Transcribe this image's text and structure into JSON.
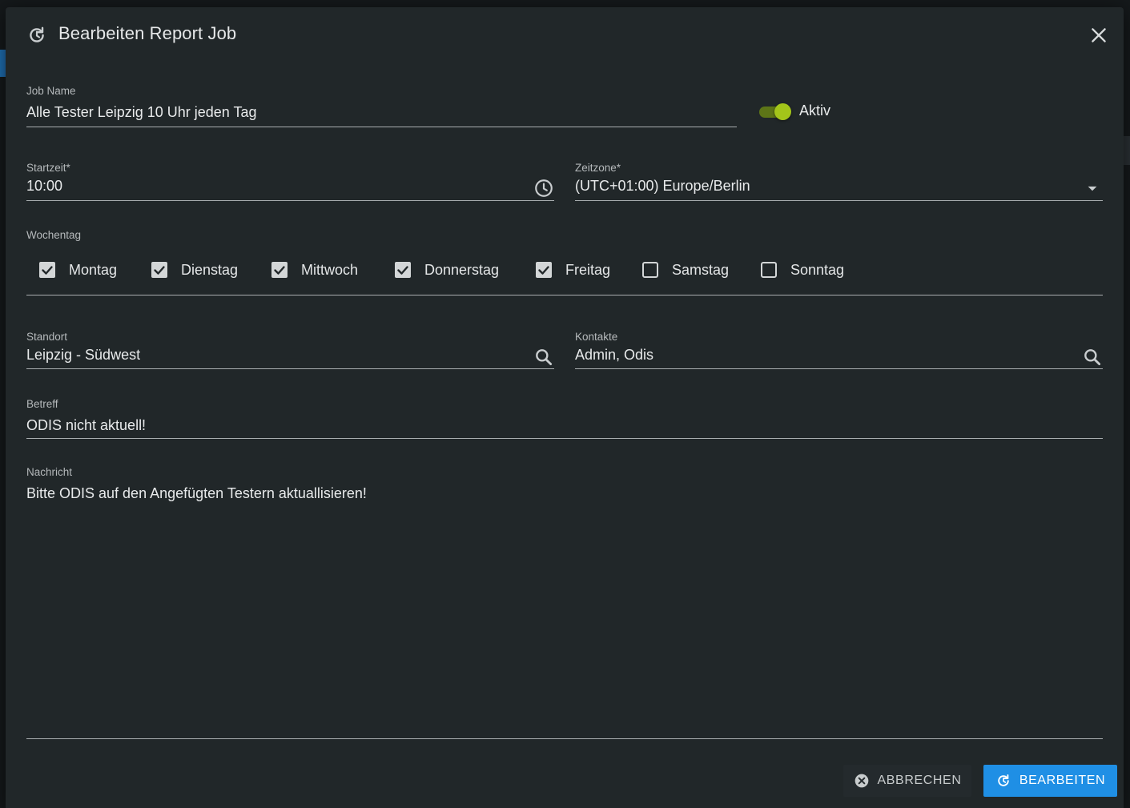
{
  "dialog": {
    "title": "Bearbeiten Report Job",
    "header_icon": "refresh-edit-icon",
    "close_icon": "close-icon"
  },
  "job_name": {
    "label": "Job Name",
    "value": "Alle Tester Leipzig 10 Uhr jeden Tag"
  },
  "active_toggle": {
    "label": "Aktiv",
    "checked": true
  },
  "start_time": {
    "label": "Startzeit*",
    "value": "10:00",
    "icon": "clock-icon"
  },
  "timezone": {
    "label": "Zeitzone*",
    "value": "(UTC+01:00) Europe/Berlin",
    "icon": "dropdown-arrow-icon"
  },
  "weekdays": {
    "label": "Wochentag",
    "days": [
      {
        "label": "Montag",
        "checked": true
      },
      {
        "label": "Dienstag",
        "checked": true
      },
      {
        "label": "Mittwoch",
        "checked": true
      },
      {
        "label": "Donnerstag",
        "checked": true
      },
      {
        "label": "Freitag",
        "checked": true
      },
      {
        "label": "Samstag",
        "checked": false
      },
      {
        "label": "Sonntag",
        "checked": false
      }
    ]
  },
  "location": {
    "label": "Standort",
    "value": "Leipzig - Südwest",
    "icon": "search-icon"
  },
  "contacts": {
    "label": "Kontakte",
    "value": "Admin, Odis",
    "icon": "search-icon"
  },
  "subject": {
    "label": "Betreff",
    "value": "ODIS nicht aktuell!"
  },
  "message": {
    "label": "Nachricht",
    "value": "Bitte ODIS auf den Angefügten Testern aktuallisieren!"
  },
  "buttons": {
    "cancel": {
      "label": "ABBRECHEN",
      "icon": "cancel-circle-icon"
    },
    "save": {
      "label": "BEARBEITEN",
      "icon": "refresh-edit-icon"
    }
  },
  "colors": {
    "dialog_bg": "#212729",
    "toggle_on": "#a3c51a",
    "primary": "#1f8fe5"
  }
}
